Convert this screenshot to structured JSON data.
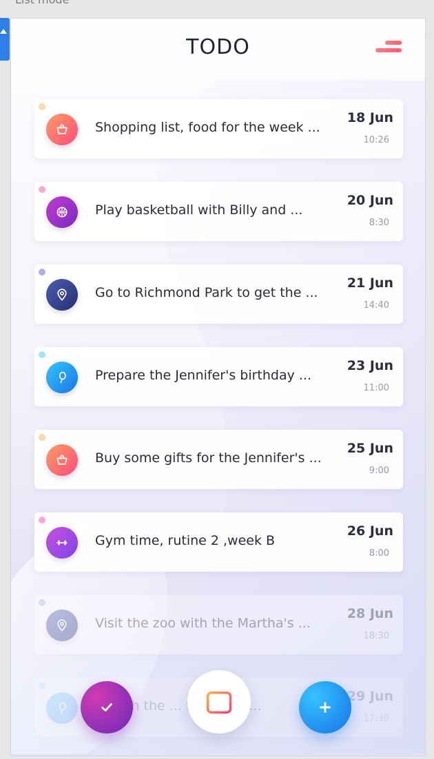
{
  "window": {
    "caption": "List mode"
  },
  "header": {
    "title": "TODO",
    "menu_icon": "menu-icon"
  },
  "tasks": [
    {
      "text": "Shopping list, food for the week ...",
      "date": "18 Jun",
      "time": "10:26",
      "icon": "basket-icon",
      "dot_color": "#ffd9a8",
      "grad": [
        "#ff9a62",
        "#ff4e7c"
      ]
    },
    {
      "text": "Play basketball with Billy and ...",
      "date": "20 Jun",
      "time": "8:30",
      "icon": "basketball-icon",
      "dot_color": "#ffa6d4",
      "grad": [
        "#c43ad0",
        "#7a2bc0"
      ]
    },
    {
      "text": "Go to Richmond Park to get the ...",
      "date": "21 Jun",
      "time": "14:40",
      "icon": "location-pin-icon",
      "dot_color": "#a9b2e8",
      "grad": [
        "#4c5bb5",
        "#25306f"
      ]
    },
    {
      "text": "Prepare the Jennifer's birthday ...",
      "date": "23 Jun",
      "time": "11:00",
      "icon": "balloon-icon",
      "dot_color": "#9fe6fb",
      "grad": [
        "#2ec6ff",
        "#1d75e6"
      ]
    },
    {
      "text": "Buy some gifts for the Jennifer's ...",
      "date": "25 Jun",
      "time": "9:00",
      "icon": "basket-icon",
      "dot_color": "#ffd9a8",
      "grad": [
        "#ff9a62",
        "#ff4e7c"
      ]
    },
    {
      "text": "Gym time, rutine 2 ,week B",
      "date": "26 Jun",
      "time": "8:00",
      "icon": "dumbbell-icon",
      "dot_color": "#ffa6d4",
      "grad": [
        "#c94fe0",
        "#7a45e6"
      ]
    },
    {
      "text": "Visit the zoo with the  Martha's  ...",
      "date": "28 Jun",
      "time": "18:30",
      "icon": "location-pin-icon",
      "dot_color": "#a9b2e8",
      "grad": [
        "#4c5bb5",
        "#25306f"
      ]
    },
    {
      "text": "... with the ... Saturday ...",
      "date": "29 Jun",
      "time": "17:30",
      "icon": "balloon-icon",
      "dot_color": "#9fe6fb",
      "grad": [
        "#2ec6ff",
        "#1d75e6"
      ]
    }
  ],
  "actions": {
    "done_icon": "checkmark-icon",
    "calendar_icon": "calendar-icon",
    "add_icon": "plus-icon"
  },
  "colors": {
    "primary_gradient": [
      "#d13bb3",
      "#6a2ab8"
    ],
    "add_gradient": [
      "#35c3ff",
      "#1772e8"
    ],
    "accent": "#ff5d6c",
    "text": "#2a2d36"
  }
}
